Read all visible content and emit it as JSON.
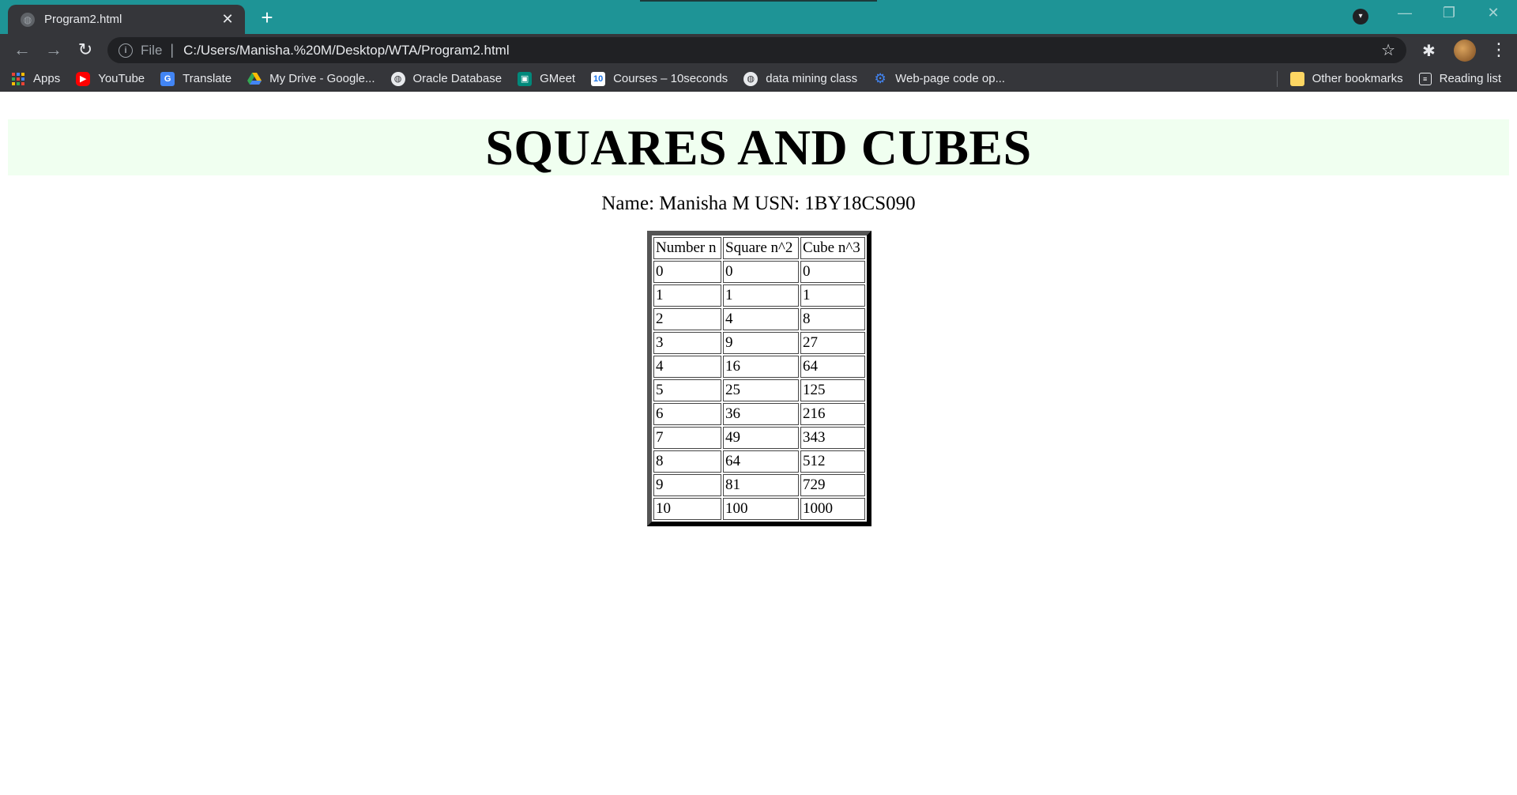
{
  "browser": {
    "tab_title": "Program2.html",
    "tab_close": "✕",
    "new_tab": "+",
    "address_scheme": "File",
    "address_url": "C:/Users/Manisha.%20M/Desktop/WTA/Program2.html",
    "icons": {
      "back": "back-arrow-icon",
      "forward": "forward-arrow-icon",
      "reload": "reload-icon",
      "info": "info-icon",
      "star": "star-icon",
      "extensions": "puzzle-icon",
      "menu": "menu-dots-icon"
    }
  },
  "bookmarks": {
    "items": [
      {
        "label": "Apps",
        "icon": "apps-grid-icon",
        "color": "#ea4335"
      },
      {
        "label": "YouTube",
        "icon": "youtube-icon",
        "color": "#ff0000"
      },
      {
        "label": "Translate",
        "icon": "translate-icon",
        "color": "#4285f4"
      },
      {
        "label": "My Drive - Google...",
        "icon": "drive-icon",
        "color": "#fbbc04"
      },
      {
        "label": "Oracle Database",
        "icon": "globe-icon",
        "color": "#9aa0a6"
      },
      {
        "label": "GMeet",
        "icon": "meet-icon",
        "color": "#00897b"
      },
      {
        "label": "Courses – 10seconds",
        "icon": "courses-icon",
        "color": "#1a73e8"
      },
      {
        "label": "data mining class",
        "icon": "globe-icon",
        "color": "#9aa0a6"
      },
      {
        "label": "Web-page code op...",
        "icon": "gear-icon",
        "color": "#4285f4"
      }
    ],
    "other_bookmarks": "Other bookmarks",
    "reading_list": "Reading list"
  },
  "page": {
    "heading": "SQUARES AND CUBES",
    "student_line": "Name: Manisha M USN: 1BY18CS090",
    "table": {
      "headers": [
        "Number n",
        "Square n^2",
        "Cube n^3"
      ],
      "rows": [
        [
          "0",
          "0",
          "0"
        ],
        [
          "1",
          "1",
          "1"
        ],
        [
          "2",
          "4",
          "8"
        ],
        [
          "3",
          "9",
          "27"
        ],
        [
          "4",
          "16",
          "64"
        ],
        [
          "5",
          "25",
          "125"
        ],
        [
          "6",
          "36",
          "216"
        ],
        [
          "7",
          "49",
          "343"
        ],
        [
          "8",
          "64",
          "512"
        ],
        [
          "9",
          "81",
          "729"
        ],
        [
          "10",
          "100",
          "1000"
        ]
      ]
    },
    "colors": {
      "heading_band": "#f0fff0",
      "tabstrip": "#1e9496"
    }
  }
}
